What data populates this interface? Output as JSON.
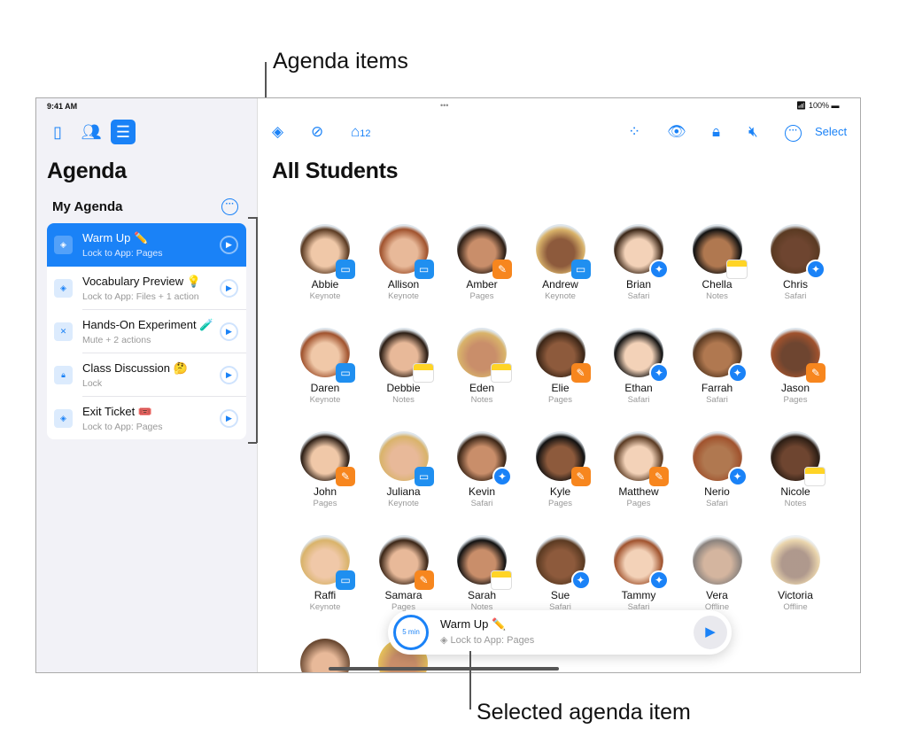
{
  "callouts": {
    "agenda_items": "Agenda items",
    "selected_item": "Selected agenda item"
  },
  "status": {
    "time": "9:41 AM",
    "battery": "100%"
  },
  "sidebar": {
    "title": "Agenda",
    "section": "My Agenda",
    "items": [
      {
        "title": "Warm Up ✏️",
        "subtitle": "Lock to App: Pages",
        "icon": "layers-icon",
        "selected": true
      },
      {
        "title": "Vocabulary Preview 💡",
        "subtitle": "Lock to App: Files + 1 action",
        "icon": "layers-icon"
      },
      {
        "title": "Hands-On Experiment 🧪",
        "subtitle": "Mute + 2 actions",
        "icon": "mute-icon"
      },
      {
        "title": "Class Discussion 🤔",
        "subtitle": "Lock",
        "icon": "lock-icon"
      },
      {
        "title": "Exit Ticket 🎟️",
        "subtitle": "Lock to App: Pages",
        "icon": "layers-icon"
      }
    ]
  },
  "toolbar": {
    "inbox_count": "12",
    "select_label": "Select"
  },
  "main": {
    "title": "All Students",
    "students": [
      {
        "name": "Abbie",
        "app": "Keynote"
      },
      {
        "name": "Allison",
        "app": "Keynote"
      },
      {
        "name": "Amber",
        "app": "Pages"
      },
      {
        "name": "Andrew",
        "app": "Keynote"
      },
      {
        "name": "Brian",
        "app": "Safari"
      },
      {
        "name": "Chella",
        "app": "Notes"
      },
      {
        "name": "Chris",
        "app": "Safari"
      },
      {
        "name": "Daren",
        "app": "Keynote"
      },
      {
        "name": "Debbie",
        "app": "Notes"
      },
      {
        "name": "Eden",
        "app": "Notes"
      },
      {
        "name": "Elie",
        "app": "Pages"
      },
      {
        "name": "Ethan",
        "app": "Safari"
      },
      {
        "name": "Farrah",
        "app": "Safari"
      },
      {
        "name": "Jason",
        "app": "Pages"
      },
      {
        "name": "John",
        "app": "Pages"
      },
      {
        "name": "Juliana",
        "app": "Keynote"
      },
      {
        "name": "Kevin",
        "app": "Safari"
      },
      {
        "name": "Kyle",
        "app": "Pages"
      },
      {
        "name": "Matthew",
        "app": "Pages"
      },
      {
        "name": "Nerio",
        "app": "Safari"
      },
      {
        "name": "Nicole",
        "app": "Notes"
      },
      {
        "name": "Raffi",
        "app": "Keynote"
      },
      {
        "name": "Samara",
        "app": "Pages"
      },
      {
        "name": "Sarah",
        "app": "Notes"
      },
      {
        "name": "Sue",
        "app": "Safari"
      },
      {
        "name": "Tammy",
        "app": "Safari"
      },
      {
        "name": "Vera",
        "app": "Offline"
      },
      {
        "name": "Victoria",
        "app": "Offline"
      }
    ]
  },
  "banner": {
    "timer": "5 min",
    "title": "Warm Up ✏️",
    "subtitle": "Lock to App: Pages"
  },
  "colors": {
    "accent": "#1a82f7",
    "pages": "#f7861e",
    "sidebar_bg": "#f2f2f7"
  }
}
